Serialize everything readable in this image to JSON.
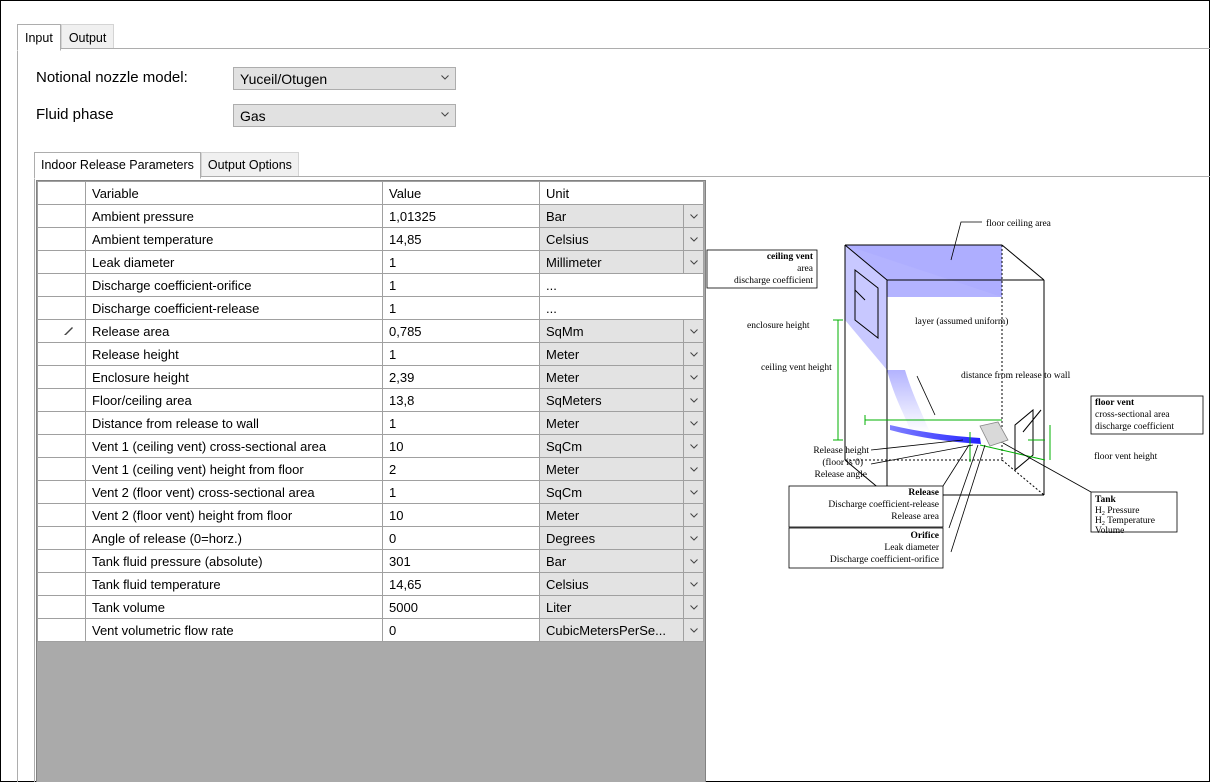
{
  "tabs": [
    "Input",
    "Output"
  ],
  "form": {
    "nozzle_label": "Notional nozzle model:",
    "nozzle_value": "Yuceil/Otugen",
    "phase_label": "Fluid phase",
    "phase_value": "Gas"
  },
  "inner_tabs": [
    "Indoor Release Parameters",
    "Output Options"
  ],
  "grid": {
    "headers": {
      "variable": "Variable",
      "value": "Value",
      "unit": "Unit"
    },
    "rows": [
      {
        "variable": "Ambient pressure",
        "value": "1,01325",
        "unit": "Bar",
        "dropdown": true
      },
      {
        "variable": "Ambient temperature",
        "value": "14,85",
        "unit": "Celsius",
        "dropdown": true
      },
      {
        "variable": "Leak diameter",
        "value": "1",
        "unit": "Millimeter",
        "dropdown": true
      },
      {
        "variable": "Discharge coefficient-orifice",
        "value": "1",
        "unit": "...",
        "dropdown": false
      },
      {
        "variable": "Discharge coefficient-release",
        "value": "1",
        "unit": "...",
        "dropdown": false
      },
      {
        "variable": "Release area",
        "value": "0,785",
        "unit": "SqMm",
        "dropdown": true,
        "editing": true
      },
      {
        "variable": "Release height",
        "value": "1",
        "unit": "Meter",
        "dropdown": true
      },
      {
        "variable": "Enclosure height",
        "value": "2,39",
        "unit": "Meter",
        "dropdown": true
      },
      {
        "variable": "Floor/ceiling area",
        "value": "13,8",
        "unit": "SqMeters",
        "dropdown": true
      },
      {
        "variable": "Distance from release to wall",
        "value": "1",
        "unit": "Meter",
        "dropdown": true
      },
      {
        "variable": "Vent 1 (ceiling vent) cross-sectional area",
        "value": "10",
        "unit": "SqCm",
        "dropdown": true
      },
      {
        "variable": "Vent 1 (ceiling vent) height from floor",
        "value": "2",
        "unit": "Meter",
        "dropdown": true
      },
      {
        "variable": "Vent 2 (floor vent) cross-sectional area",
        "value": "1",
        "unit": "SqCm",
        "dropdown": true
      },
      {
        "variable": "Vent 2 (floor vent) height from floor",
        "value": "10",
        "unit": "Meter",
        "dropdown": true
      },
      {
        "variable": "Angle of release (0=horz.)",
        "value": "0",
        "unit": "Degrees",
        "dropdown": true
      },
      {
        "variable": "Tank fluid pressure (absolute)",
        "value": "301",
        "unit": "Bar",
        "dropdown": true
      },
      {
        "variable": "Tank fluid temperature",
        "value": "14,65",
        "unit": "Celsius",
        "dropdown": true
      },
      {
        "variable": "Tank volume",
        "value": "5000",
        "unit": "Liter",
        "dropdown": true
      },
      {
        "variable": "Vent volumetric flow rate",
        "value": "0",
        "unit": "CubicMetersPerSe...",
        "dropdown": true
      }
    ]
  },
  "diagram": {
    "floor_ceiling_area": "floor ceiling area",
    "ceiling_vent_title": "ceiling vent",
    "ceiling_vent_area": "area",
    "ceiling_vent_dc": "discharge coefficient",
    "enclosure_height": "enclosure height",
    "layer": "layer (assumed uniform)",
    "ceiling_vent_height": "ceiling vent height",
    "distance_to_wall": "distance from release to wall",
    "floor_vent_title": "floor vent",
    "floor_vent_area": "cross-sectional area",
    "floor_vent_dc": "discharge coefficient",
    "floor_vent_height": "floor vent height",
    "release_height": "Release height",
    "floor_is_0": "(floor is 0)",
    "release_angle": "Release angle",
    "release_title": "Release",
    "release_dc": "Discharge coefficient-release",
    "release_area": "Release area",
    "orifice_title": "Orifice",
    "orifice_leak": "Leak diameter",
    "orifice_dc": "Discharge coefficient-orifice",
    "tank_title": "Tank",
    "tank_h2": "H",
    "tank_sub": "2",
    "tank_pressure": " Pressure",
    "tank_temperature": " Temperature",
    "tank_volume": "Volume"
  },
  "colors": {
    "plume": "#3333ff",
    "layer": "#b3b3ff",
    "tank": "#d9d9d9",
    "dim": "#00b000"
  }
}
